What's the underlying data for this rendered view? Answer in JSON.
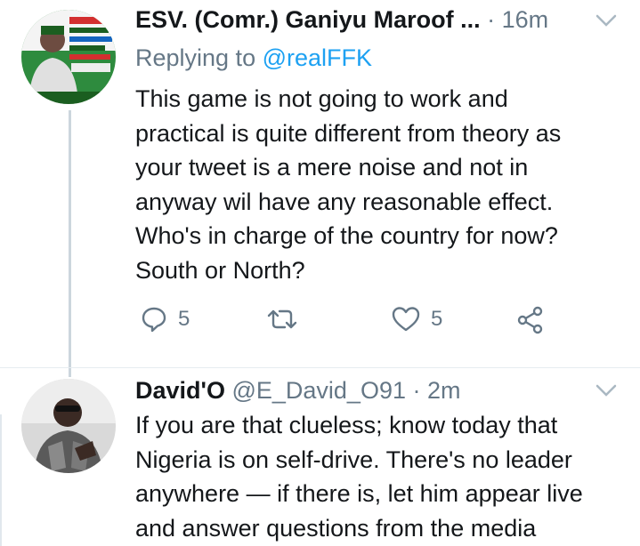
{
  "tweets": [
    {
      "name": "ESV. (Comr.) Ganiyu Maroof ...",
      "handle": "",
      "time": "16m",
      "replying_prefix": "Replying to",
      "replying_to": "@realFFK",
      "lines": [
        "This game is not going to work and",
        "practical is quite different from theory as",
        "your tweet is a mere noise and not in",
        "anyway wil have any reasonable effect.",
        "Who's in charge of the country for now?",
        "South or North?"
      ],
      "reply_count": "5",
      "retweet_count": "",
      "like_count": "5",
      "icons": [
        "reply-icon",
        "retweet-icon",
        "like-icon",
        "share-icon",
        "chevron-down-icon"
      ]
    },
    {
      "name": "David'O",
      "handle": "@E_David_O91",
      "time": "2m",
      "lines": [
        "If you are that clueless; know today that",
        "Nigeria is on self-drive. There's no leader",
        "anywhere — if there is, let him appear live",
        "and answer questions from the media"
      ]
    }
  ],
  "colors": {
    "text": "#14171a",
    "secondary": "#657786",
    "link": "#1da1f2",
    "thread_line": "#ccd6dd"
  }
}
